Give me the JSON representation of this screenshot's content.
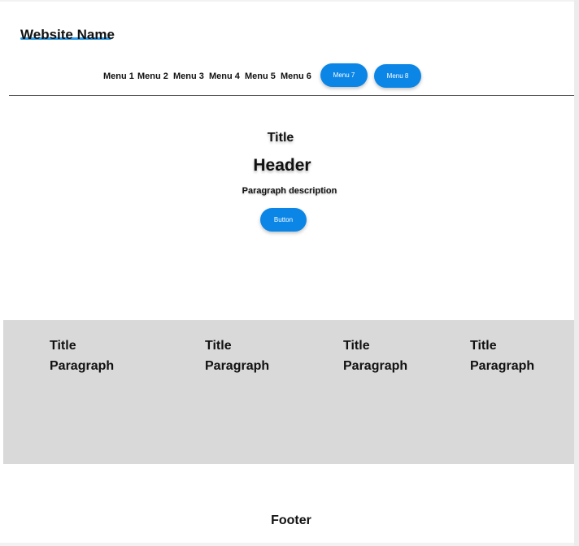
{
  "site": {
    "name": "Website Name",
    "accent_color": "#2e9be6"
  },
  "nav": {
    "links": [
      "Menu 1",
      "Menu 2",
      "Menu 3",
      "Menu 4",
      "Menu 5",
      "Menu 6"
    ],
    "pill_buttons": [
      "Menu 7",
      "Menu 8"
    ],
    "pill_color": "#0b86e6"
  },
  "hero": {
    "title": "Title",
    "header": "Header",
    "description": "Paragraph description",
    "button_label": "Button"
  },
  "features": {
    "background": "#d9d9d9",
    "items": [
      {
        "title": "Title",
        "text": "Paragraph"
      },
      {
        "title": "Title",
        "text": "Paragraph"
      },
      {
        "title": "Title",
        "text": "Paragraph"
      },
      {
        "title": "Title",
        "text": "Paragraph"
      }
    ]
  },
  "footer": {
    "text": "Footer"
  }
}
